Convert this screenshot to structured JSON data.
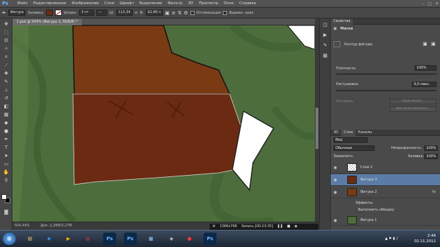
{
  "menubar": {
    "logo": "Ps",
    "items": [
      "Файл",
      "Редактирование",
      "Изображение",
      "Слои",
      "Шрифт",
      "Выделение",
      "Фильтр",
      "3D",
      "Просмотр",
      "Окно",
      "Справка"
    ]
  },
  "options": {
    "shape_mode": "Фигура",
    "fill_label": "Заливка:",
    "stroke_label": "Штрих:",
    "stroke_size": "3 пт",
    "width_label": "Ш:",
    "width_value": "113,34",
    "height_label": "В:",
    "height_value": "62,88 п",
    "align_edges": "Выровн. края",
    "auto_option": "Оптимизация",
    "fill_color": "#6b2a12"
  },
  "document": {
    "tab_title": "1.psd @ 504% (Фигура 3, RGB/8) *",
    "zoom": "504,44%",
    "doc_info": "Док: 2,29M/2,27M"
  },
  "recorder": {
    "resolution": "1366x768",
    "recording": "Запись [00:23:35]"
  },
  "properties": {
    "tab": "Свойства",
    "section": "Маски",
    "shape_contour": "Контур фигуры",
    "density_label": "Плотность:",
    "density_value": "100%",
    "feather_label": "Растушевка:",
    "feather_value": "0,0 пикс.",
    "refine_label": "Уточнить:",
    "mask_edge_button": "Край маски...",
    "color_range_button": "Цветовой диапазон..."
  },
  "layers_panel": {
    "tabs": [
      "3D",
      "Слои",
      "Каналы"
    ],
    "filter": "Вид",
    "blend_mode": "Обычные",
    "opacity_label": "Непрозрачность:",
    "opacity_value": "100%",
    "lock_label": "Закрепить:",
    "fill_label": "Заливка:",
    "fill_value": "100%",
    "layers": [
      {
        "name": "Слой 2"
      },
      {
        "name": "Фигура 3"
      },
      {
        "name": "Фигура 2"
      },
      {
        "name": "Эффекты"
      },
      {
        "name": "Выполнить обводку"
      },
      {
        "name": "Фигура 1"
      }
    ]
  },
  "taskbar": {
    "time": "2:46",
    "date": "02.11.2012",
    "apps": [
      "Ps",
      "Ps",
      "Ps"
    ]
  },
  "colors": {
    "canvas_green": "#4a6b3a",
    "shape_brown": "#6b2a12",
    "selected_layer": "#5b7ca6"
  }
}
